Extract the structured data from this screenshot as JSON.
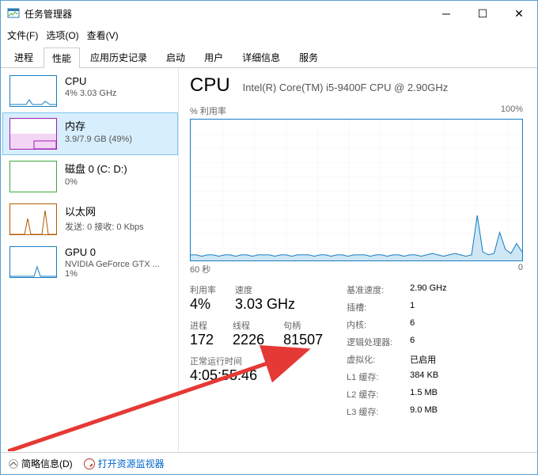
{
  "window": {
    "title": "任务管理器"
  },
  "menu": {
    "file": "文件(F)",
    "options": "选项(O)",
    "view": "查看(V)"
  },
  "tabs": {
    "processes": "进程",
    "performance": "性能",
    "appHistory": "应用历史记录",
    "startup": "启动",
    "users": "用户",
    "details": "详细信息",
    "services": "服务"
  },
  "sidebar": {
    "cpu": {
      "name": "CPU",
      "detail": "4% 3.03 GHz"
    },
    "mem": {
      "name": "内存",
      "detail": "3.9/7.9 GB (49%)"
    },
    "disk": {
      "name": "磁盘 0 (C: D:)",
      "detail": "0%"
    },
    "eth": {
      "name": "以太网",
      "detail": "发送: 0 接收: 0 Kbps"
    },
    "gpu": {
      "name": "GPU 0",
      "detail": "NVIDIA GeForce GTX ... 1%"
    }
  },
  "main": {
    "title": "CPU",
    "model": "Intel(R) Core(TM) i5-9400F CPU @ 2.90GHz",
    "chart_top_left": "% 利用率",
    "chart_top_right": "100%",
    "chart_bot_left": "60 秒",
    "chart_bot_right": "0",
    "stats": {
      "util_lbl": "利用率",
      "util_val": "4%",
      "speed_lbl": "速度",
      "speed_val": "3.03 GHz",
      "proc_lbl": "进程",
      "proc_val": "172",
      "thread_lbl": "线程",
      "thread_val": "2226",
      "handle_lbl": "句柄",
      "handle_val": "81507",
      "uptime_lbl": "正常运行时间",
      "uptime_val": "4:05:55:46"
    },
    "right": {
      "base_k": "基准速度:",
      "base_v": "2.90 GHz",
      "socket_k": "插槽:",
      "socket_v": "1",
      "cores_k": "内核:",
      "cores_v": "6",
      "lp_k": "逻辑处理器:",
      "lp_v": "6",
      "virt_k": "虚拟化:",
      "virt_v": "已启用",
      "l1_k": "L1 缓存:",
      "l1_v": "384 KB",
      "l2_k": "L2 缓存:",
      "l2_v": "1.5 MB",
      "l3_k": "L3 缓存:",
      "l3_v": "9.0 MB"
    }
  },
  "status": {
    "less": "简略信息(D)",
    "resmon": "打开资源监视器"
  },
  "chart_data": {
    "type": "line",
    "title": "% 利用率",
    "ylabel": "利用率",
    "ylim": [
      0,
      100
    ],
    "xrange_seconds": 60,
    "series": [
      {
        "name": "CPU",
        "values": [
          4,
          4,
          3,
          4,
          4,
          3,
          4,
          4,
          3,
          4,
          4,
          3,
          4,
          4,
          4,
          3,
          4,
          4,
          3,
          4,
          4,
          4,
          3,
          4,
          4,
          3,
          4,
          4,
          3,
          4,
          4,
          4,
          3,
          4,
          4,
          3,
          4,
          4,
          3,
          4,
          4,
          3,
          4,
          5,
          4,
          3,
          4,
          5,
          4,
          3,
          4,
          32,
          6,
          4,
          5,
          20,
          8,
          5,
          12,
          6
        ]
      }
    ]
  }
}
